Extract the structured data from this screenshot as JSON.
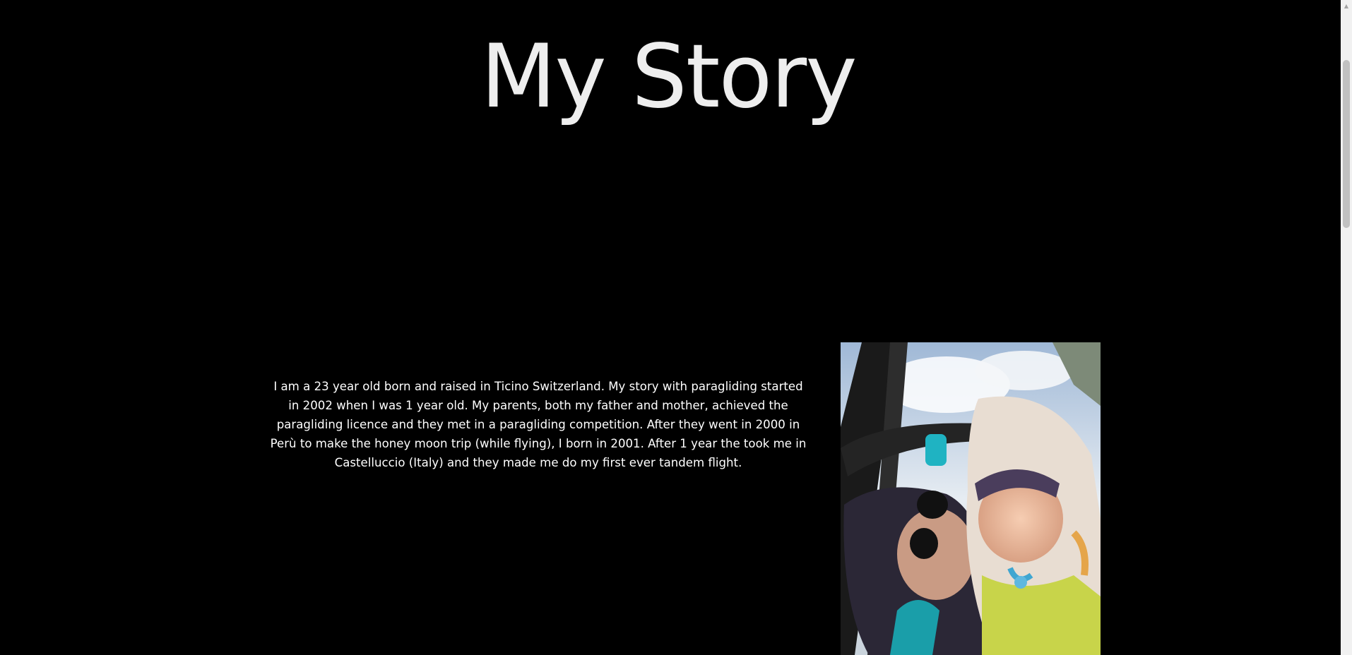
{
  "page": {
    "title": "My Story",
    "story_text": "I am a 23 year old born and raised in Ticino Switzerland. My story with paragliding started in 2002 when I was 1 year old. My parents, both my father and mother, achieved the paragliding licence and they met in a paragliding competition. After they went in 2000 in Perù to make the honey moon trip (while flying), I born in 2001. After 1 year the took me in Castelluccio (Italy) and they made me do my first ever tandem flight."
  },
  "colors": {
    "background": "#000000",
    "title": "#eeeeee",
    "text": "#ffffff"
  },
  "scrollbar": {
    "up_arrow_icon": "chevron-up-icon"
  }
}
